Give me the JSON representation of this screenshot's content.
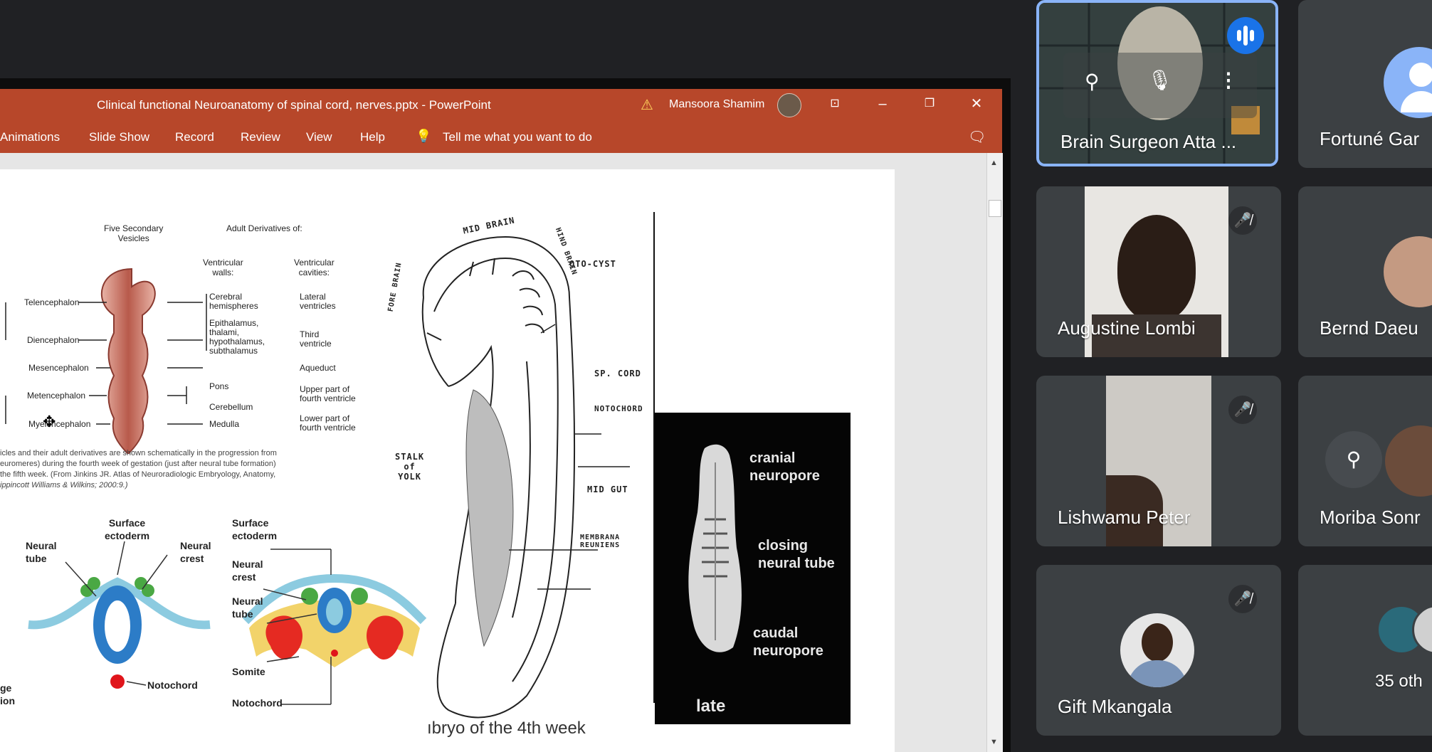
{
  "powerpoint": {
    "title": "Clinical functional Neuroanatomy of spinal cord, nerves.pptx  -  PowerPoint",
    "user": "Mansoora Shamim",
    "ribbon_tabs": [
      "Animations",
      "Slide Show",
      "Record",
      "Review",
      "View",
      "Help"
    ],
    "tell_me": "Tell me what you want to do"
  },
  "slide": {
    "vesicles": {
      "header_left": "Five Secondary\nVesicles",
      "header_right": "Adult Derivatives of:",
      "col_walls": "Ventricular\nwalls:",
      "col_cavities": "Ventricular\ncavities:",
      "rows": [
        "Telencephalon",
        "Diencephalon",
        "Mesencephalon",
        "Metencephalon",
        "Myelencephalon"
      ],
      "walls": [
        "Cerebral\nhemispheres",
        "Epithalamus,\nthalami,\nhypothalamus,\nsubthalamus",
        "Pons",
        "Cerebellum",
        "Medulla"
      ],
      "cavities": [
        "Lateral\nventricles",
        "Third\nventricle",
        "Aqueduct",
        "Upper part of\nfourth ventricle",
        "Lower part of\nfourth ventricle"
      ],
      "caption_lines": [
        "icles and their adult derivatives are shown schematically in the progression from",
        "euromeres) during the fourth week of gestation (just after neural tube formation)",
        "the fifth week. (From Jinkins JR. Atlas of Neuroradiologic Embryology, Anatomy,",
        "ippincott Williams & Wilkins; 2000:9.)"
      ]
    },
    "cross_section_left": {
      "surface_ectoderm": "Surface\nectoderm",
      "neural_tube": "Neural\ntube",
      "neural_crest": "Neural\ncrest",
      "notochord": "Notochord",
      "partial": "ge\nion"
    },
    "cross_section_right": {
      "surface_ectoderm": "Surface\nectoderm",
      "neural_crest": "Neural\ncrest",
      "neural_tube": "Neural\ntube",
      "somite": "Somite",
      "notochord": "Notochord"
    },
    "embryo": {
      "mid_brain": "MID BRAIN",
      "hind_brain": "HIND BRAIN",
      "fore_brain": "FORE BRAIN",
      "oto_cyst": "OTO-CYST",
      "sp_cord": "SP. CORD",
      "notochord": "NOTOCHORD",
      "stalk_of_yolk": "STALK\nof\nYOLK",
      "mid_gut": "MID GUT",
      "membrana": "MEMBRANA\nREUNIENS"
    },
    "photo": {
      "cranial": "cranial\nneuropore",
      "closing": "closing\nneural tube",
      "caudal": "caudal\nneuropore",
      "late": "late"
    },
    "caption": "ıbryo of the 4th week"
  },
  "participants": [
    {
      "name": "Brain Surgeon Atta ...",
      "speaking": true
    },
    {
      "name": "Fortuné Gar"
    },
    {
      "name": "Augustine Lombi",
      "muted": true
    },
    {
      "name": "Bernd Daeu"
    },
    {
      "name": "Lishwamu Peter",
      "muted": true
    },
    {
      "name": "Moriba Sonr"
    },
    {
      "name": "Gift Mkangala",
      "muted": true
    },
    {
      "name": "35 oth"
    }
  ],
  "colors": {
    "ppt_accent": "#b7472a",
    "meet_bg": "#202124",
    "tile_bg": "#3c4043",
    "speaking_border": "#8ab4f8",
    "speaking_badge": "#1a73e8"
  }
}
